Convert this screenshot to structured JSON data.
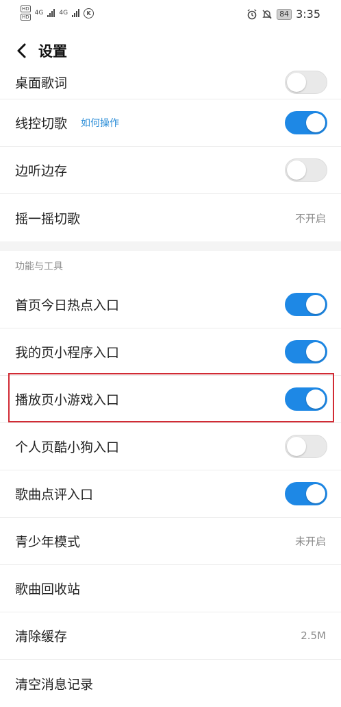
{
  "status_bar": {
    "hd1": "HD",
    "hd2": "HD",
    "net1": "4G",
    "net2": "4G",
    "carrier_icon": "K",
    "battery": "84",
    "time": "3:35"
  },
  "header": {
    "title": "设置"
  },
  "rows_top": [
    {
      "label": "桌面歌词",
      "type": "toggle",
      "on": false
    },
    {
      "label": "线控切歌",
      "hint": "如何操作",
      "type": "toggle",
      "on": true
    },
    {
      "label": "边听边存",
      "type": "toggle",
      "on": false
    },
    {
      "label": "摇一摇切歌",
      "type": "value",
      "value": "不开启"
    }
  ],
  "section": {
    "title": "功能与工具"
  },
  "rows_tools": [
    {
      "label": "首页今日热点入口",
      "type": "toggle",
      "on": true
    },
    {
      "label": "我的页小程序入口",
      "type": "toggle",
      "on": true
    },
    {
      "label": "播放页小游戏入口",
      "type": "toggle",
      "on": true
    },
    {
      "label": "个人页酷小狗入口",
      "type": "toggle",
      "on": false
    },
    {
      "label": "歌曲点评入口",
      "type": "toggle",
      "on": true
    },
    {
      "label": "青少年模式",
      "type": "value",
      "value": "未开启"
    },
    {
      "label": "歌曲回收站",
      "type": "none"
    },
    {
      "label": "清除缓存",
      "type": "value",
      "value": "2.5M"
    },
    {
      "label": "清空消息记录",
      "type": "none"
    }
  ],
  "colors": {
    "accent": "#1e88e5",
    "highlight_border": "#d12b34"
  }
}
